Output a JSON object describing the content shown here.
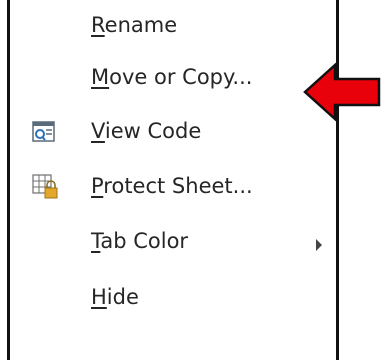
{
  "context_menu": {
    "items": [
      {
        "prefix": "",
        "accel": "R",
        "rest": "ename",
        "icon": ""
      },
      {
        "prefix": "",
        "accel": "M",
        "rest": "ove or Copy...",
        "icon": ""
      },
      {
        "prefix": "",
        "accel": "V",
        "rest": "iew Code",
        "icon": "view-code-icon"
      },
      {
        "prefix": "",
        "accel": "P",
        "rest": "rotect Sheet...",
        "icon": "protect-sheet-icon"
      },
      {
        "prefix": "",
        "accel": "T",
        "rest": "ab Color",
        "icon": "",
        "has_submenu": true
      },
      {
        "prefix": "",
        "accel": "H",
        "rest": "ide",
        "icon": ""
      }
    ]
  },
  "annotation": {
    "arrow_color": "#e8000b",
    "arrow_icon": "left-arrow-icon"
  }
}
